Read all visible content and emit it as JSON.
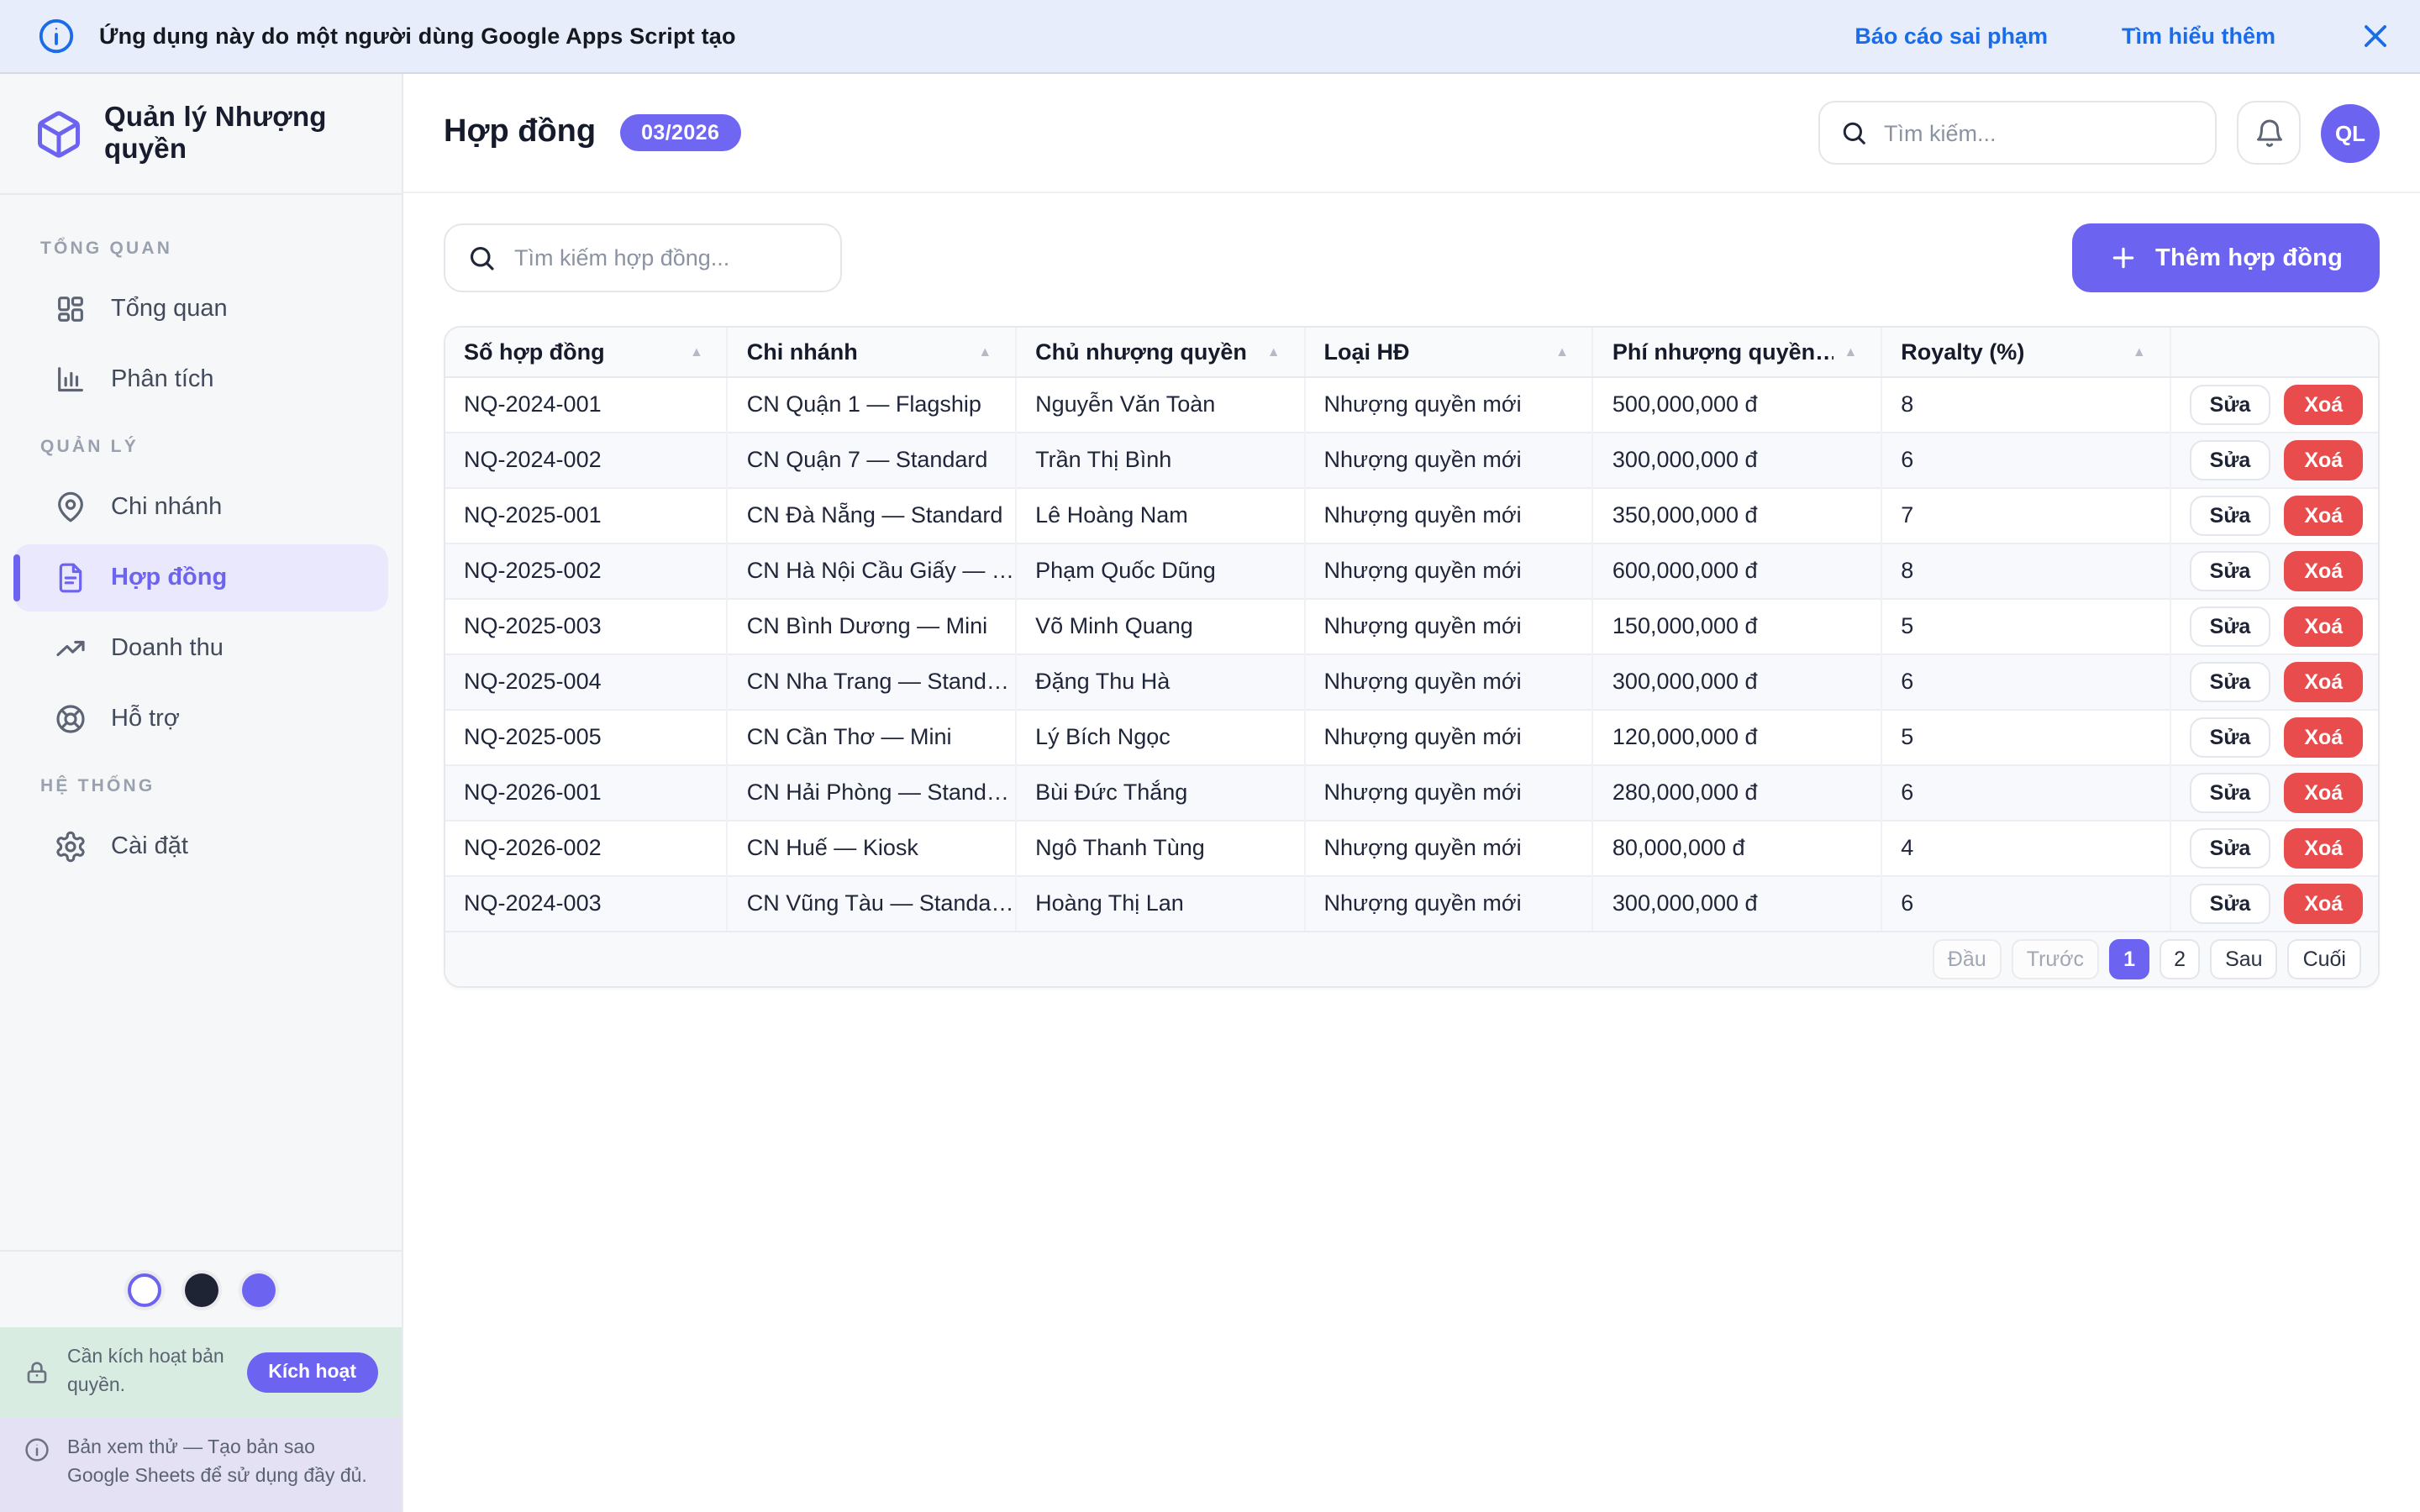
{
  "banner": {
    "text": "Ứng dụng này do một người dùng Google Apps Script tạo",
    "report_link": "Báo cáo sai phạm",
    "learn_more_link": "Tìm hiểu thêm"
  },
  "sidebar": {
    "app_title": "Quản lý Nhượng quyền",
    "sections": [
      {
        "label": "TỔNG QUAN",
        "items": [
          {
            "label": "Tổng quan",
            "icon": "dashboard-grid-icon",
            "active": false
          },
          {
            "label": "Phân tích",
            "icon": "bar-chart-icon",
            "active": false
          }
        ]
      },
      {
        "label": "QUẢN LÝ",
        "items": [
          {
            "label": "Chi nhánh",
            "icon": "map-pin-icon",
            "active": false
          },
          {
            "label": "Hợp đồng",
            "icon": "file-text-icon",
            "active": true
          },
          {
            "label": "Doanh thu",
            "icon": "trending-up-icon",
            "active": false
          },
          {
            "label": "Hỗ trợ",
            "icon": "life-buoy-icon",
            "active": false
          }
        ]
      },
      {
        "label": "HỆ THỐNG",
        "items": [
          {
            "label": "Cài đặt",
            "icon": "gear-icon",
            "active": false
          }
        ]
      }
    ],
    "license_notice": {
      "text": "Cần kích hoạt bản quyền.",
      "button": "Kích hoạt"
    },
    "trial_notice": "Bản xem thử — Tạo bản sao Google Sheets để sử dụng đầy đủ."
  },
  "header": {
    "title": "Hợp đồng",
    "badge": "03/2026",
    "search_placeholder": "Tìm kiếm...",
    "avatar_initials": "QL"
  },
  "toolbar": {
    "search_placeholder": "Tìm kiếm hợp đồng...",
    "add_button": "Thêm hợp đồng"
  },
  "table": {
    "columns": [
      "Số hợp đồng",
      "Chi nhánh",
      "Chủ nhượng quyền",
      "Loại HĐ",
      "Phí nhượng quyền…",
      "Royalty (%)"
    ],
    "edit_label": "Sửa",
    "delete_label": "Xoá",
    "rows": [
      {
        "id": "NQ-2024-001",
        "branch": "CN Quận 1 — Flagship",
        "owner": "Nguyễn Văn Toàn",
        "type": "Nhượng quyền mới",
        "fee": "500,000,000 đ",
        "royalty": "8"
      },
      {
        "id": "NQ-2024-002",
        "branch": "CN Quận 7 — Standard",
        "owner": "Trần Thị Bình",
        "type": "Nhượng quyền mới",
        "fee": "300,000,000 đ",
        "royalty": "6"
      },
      {
        "id": "NQ-2025-001",
        "branch": "CN Đà Nẵng — Standard",
        "owner": "Lê Hoàng Nam",
        "type": "Nhượng quyền mới",
        "fee": "350,000,000 đ",
        "royalty": "7"
      },
      {
        "id": "NQ-2025-002",
        "branch": "CN Hà Nội Cầu Giấy — …",
        "owner": "Phạm Quốc Dũng",
        "type": "Nhượng quyền mới",
        "fee": "600,000,000 đ",
        "royalty": "8"
      },
      {
        "id": "NQ-2025-003",
        "branch": "CN Bình Dương — Mini",
        "owner": "Võ Minh Quang",
        "type": "Nhượng quyền mới",
        "fee": "150,000,000 đ",
        "royalty": "5"
      },
      {
        "id": "NQ-2025-004",
        "branch": "CN Nha Trang — Stand…",
        "owner": "Đặng Thu Hà",
        "type": "Nhượng quyền mới",
        "fee": "300,000,000 đ",
        "royalty": "6"
      },
      {
        "id": "NQ-2025-005",
        "branch": "CN Cần Thơ — Mini",
        "owner": "Lý Bích Ngọc",
        "type": "Nhượng quyền mới",
        "fee": "120,000,000 đ",
        "royalty": "5"
      },
      {
        "id": "NQ-2026-001",
        "branch": "CN Hải Phòng — Stand…",
        "owner": "Bùi Đức Thắng",
        "type": "Nhượng quyền mới",
        "fee": "280,000,000 đ",
        "royalty": "6"
      },
      {
        "id": "NQ-2026-002",
        "branch": "CN Huế — Kiosk",
        "owner": "Ngô Thanh Tùng",
        "type": "Nhượng quyền mới",
        "fee": "80,000,000 đ",
        "royalty": "4"
      },
      {
        "id": "NQ-2024-003",
        "branch": "CN Vũng Tàu — Standa…",
        "owner": "Hoàng Thị Lan",
        "type": "Nhượng quyền mới",
        "fee": "300,000,000 đ",
        "royalty": "6"
      }
    ]
  },
  "pagination": {
    "first": "Đầu",
    "prev": "Trước",
    "pages": [
      "1",
      "2"
    ],
    "active_page": "1",
    "next": "Sau",
    "last": "Cuối"
  },
  "colors": {
    "accent": "#6c63f1",
    "accent_light": "#eae8fc",
    "danger": "#e84c4c",
    "link_blue": "#1a6ce8",
    "banner_bg": "#e7edfb",
    "license_bg": "#d9ece1",
    "trial_bg": "#e5e1f4",
    "sidebar_bg": "#f6f7f9",
    "dark_text": "#161b2c"
  }
}
